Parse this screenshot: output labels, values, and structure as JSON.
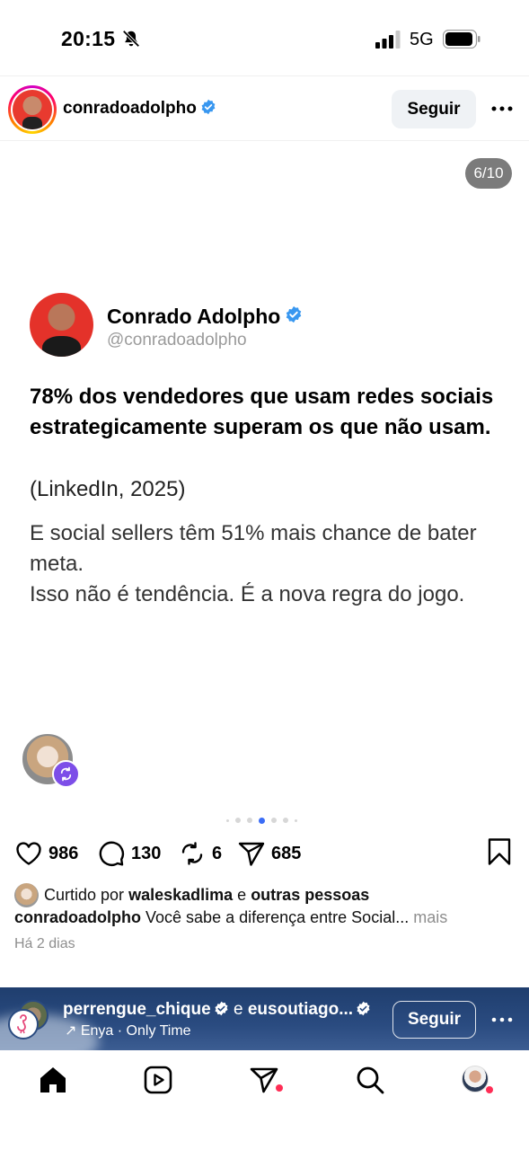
{
  "status_bar": {
    "time": "20:15",
    "network": "5G"
  },
  "post": {
    "username": "conradoadolpho",
    "follow_label": "Seguir",
    "slide_counter": "6/10",
    "card": {
      "name": "Conrado Adolpho",
      "handle": "@conradoadolpho",
      "headline": "78% dos vendedores que usam redes sociais estrategicamente superam os que não usam.",
      "source": "(LinkedIn, 2025)",
      "body_line1": "E social sellers têm 51% mais chance de bater meta.",
      "body_line2": "Isso não é tendência. É a nova regra do jogo."
    },
    "carousel": {
      "total_dots": 7,
      "active_index": 3
    },
    "actions": {
      "likes": "986",
      "comments": "130",
      "reposts": "6",
      "shares": "685"
    },
    "liked_by": {
      "prefix": "Curtido por",
      "user": "waleskadlima",
      "connector": "e",
      "others": "outras pessoas"
    },
    "caption": {
      "user": "conradoadolpho",
      "text": "Você sabe a diferença entre Social...",
      "more": "mais"
    },
    "time_ago": "Há 2 dias"
  },
  "next_post": {
    "user1": "perrengue_chique",
    "connector": "e",
    "user2": "eusoutiago...",
    "music": "Enya · Only Time",
    "follow_label": "Seguir"
  },
  "tab_bar": {
    "items": [
      "home-icon",
      "reels-icon",
      "direct-icon",
      "search-icon",
      "profile"
    ]
  },
  "colors": {
    "verified": "#3897f0",
    "repost_badge": "#7d4ee8",
    "carousel_active": "#3b6df6",
    "notification": "#ff2d55"
  }
}
